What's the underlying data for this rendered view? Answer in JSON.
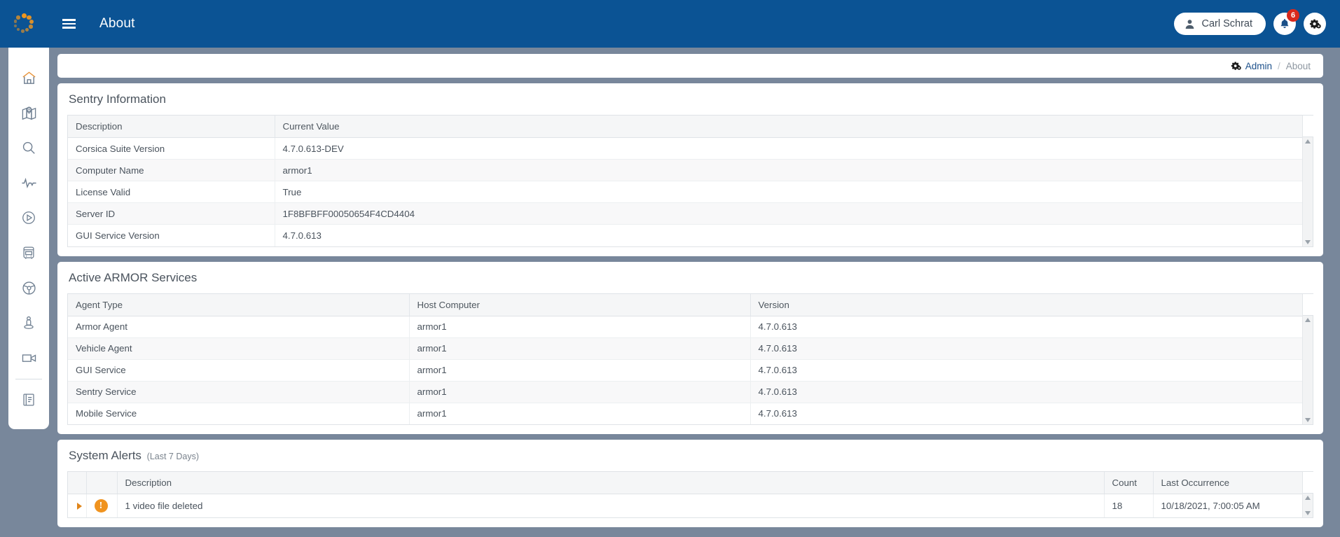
{
  "header": {
    "logo_icon": "spinner-dots-logo",
    "menu_icon": "hamburger-menu-icon",
    "title": "About",
    "user": {
      "name": "Carl Schrat",
      "icon": "user-avatar-icon"
    },
    "notifications": {
      "icon": "bell-icon",
      "count": "6"
    },
    "settings": {
      "icon": "gears-icon"
    }
  },
  "sidebar": {
    "items": [
      {
        "icon": "home-icon",
        "label": "Home"
      },
      {
        "icon": "map-pin-icon",
        "label": "Map"
      },
      {
        "icon": "search-icon",
        "label": "Search"
      },
      {
        "icon": "pulse-activity-icon",
        "label": "Activity"
      },
      {
        "icon": "play-circle-icon",
        "label": "Playback"
      },
      {
        "icon": "bus-icon",
        "label": "Vehicles"
      },
      {
        "icon": "steering-wheel-icon",
        "label": "Drivers"
      },
      {
        "icon": "person-location-icon",
        "label": "Personnel"
      },
      {
        "icon": "video-camera-icon",
        "label": "Cameras"
      },
      {
        "icon": "book-report-icon",
        "label": "Reports"
      }
    ],
    "separator_after_index": 8
  },
  "breadcrumb": {
    "icon": "gears-icon",
    "root": "Admin",
    "separator": "/",
    "current": "About"
  },
  "sentry_information": {
    "title": "Sentry Information",
    "columns": [
      "Description",
      "Current Value"
    ],
    "rows": [
      [
        "Corsica Suite Version",
        "4.7.0.613-DEV"
      ],
      [
        "Computer Name",
        "armor1"
      ],
      [
        "License Valid",
        "True"
      ],
      [
        "Server ID",
        "1F8BFBFF00050654F4CD4404"
      ],
      [
        "GUI Service Version",
        "4.7.0.613"
      ]
    ]
  },
  "active_armor_services": {
    "title": "Active ARMOR Services",
    "columns": [
      "Agent Type",
      "Host Computer",
      "Version"
    ],
    "rows": [
      [
        "Armor Agent",
        "armor1",
        "4.7.0.613"
      ],
      [
        "Vehicle Agent",
        "armor1",
        "4.7.0.613"
      ],
      [
        "GUI Service",
        "armor1",
        "4.7.0.613"
      ],
      [
        "Sentry Service",
        "armor1",
        "4.7.0.613"
      ],
      [
        "Mobile Service",
        "armor1",
        "4.7.0.613"
      ]
    ]
  },
  "system_alerts": {
    "title": "System Alerts",
    "subtitle": "(Last 7 Days)",
    "columns": [
      "",
      "",
      "Description",
      "Count",
      "Last Occurrence"
    ],
    "rows": [
      {
        "expander": "expand-row-triangle-icon",
        "severity_icon": "warning-exclamation-icon",
        "description": "1 video file deleted",
        "count": "18",
        "last_occurrence": "10/18/2021, 7:00:05 AM"
      }
    ]
  },
  "colors": {
    "header_blue": "#0b5394",
    "page_background": "#78879b",
    "accent_orange": "#f0931f",
    "badge_red": "#d9291c",
    "link_blue": "#1b4f8a"
  }
}
